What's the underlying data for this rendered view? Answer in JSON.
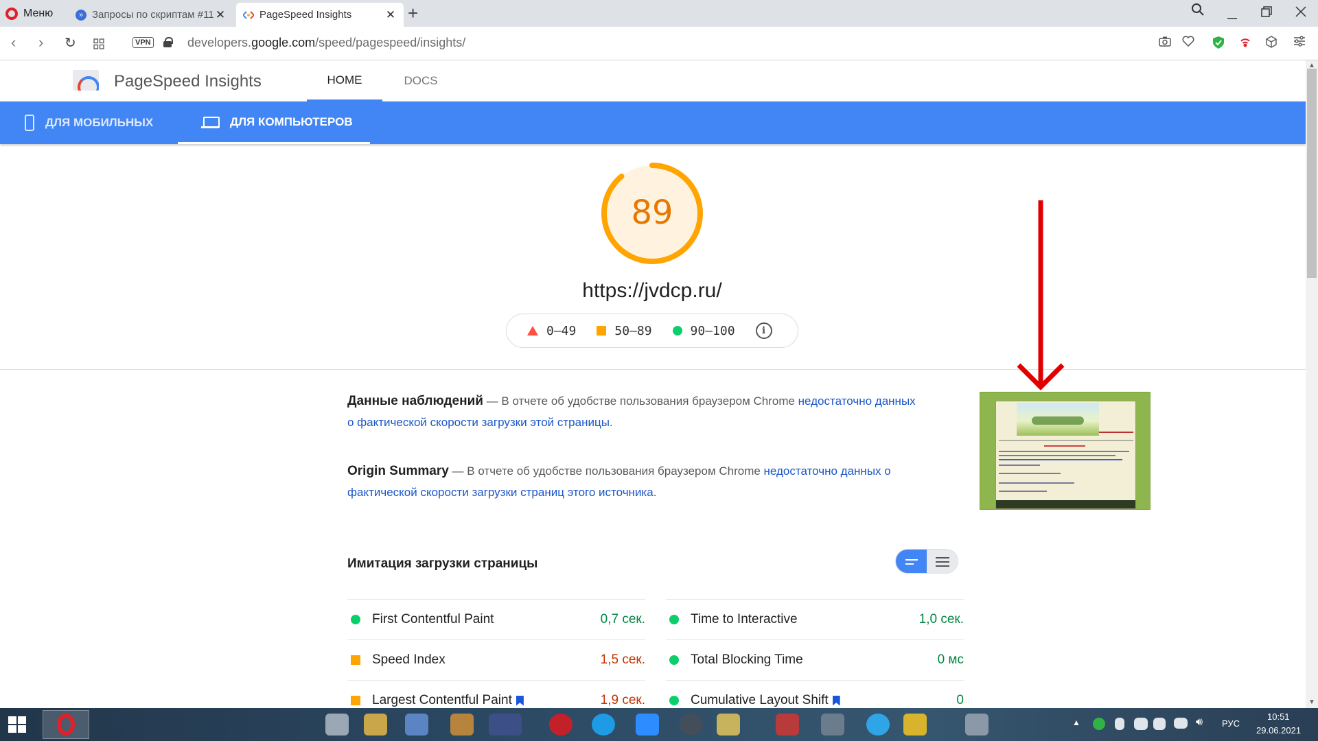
{
  "browser": {
    "menu_label": "Меню",
    "tabs": [
      {
        "label": "Запросы по скриптам #11",
        "active": false
      },
      {
        "label": "PageSpeed Insights",
        "active": true
      }
    ],
    "url_prefix": "developers.",
    "url_domain": "google.com",
    "url_path": "/speed/pagespeed/insights/",
    "vpn_label": "VPN"
  },
  "psi": {
    "title": "PageSpeed Insights",
    "nav": [
      {
        "label": "HOME",
        "active": true
      },
      {
        "label": "DOCS",
        "active": false
      }
    ],
    "device_tabs": [
      {
        "label": "ДЛЯ МОБИЛЬНЫХ",
        "active": false
      },
      {
        "label": "ДЛЯ КОМПЬЮТЕРОВ",
        "active": true
      }
    ],
    "score": "89",
    "score_value": 89,
    "score_color": "#ffa400",
    "tested_url": "https://jvdcp.ru/",
    "legend": [
      {
        "range": "0–49",
        "color": "#ff4e42"
      },
      {
        "range": "50–89",
        "color": "#ffa400"
      },
      {
        "range": "90–100",
        "color": "#0cce6b"
      }
    ],
    "field_data": {
      "title": "Данные наблюдений",
      "text": " — В отчете об удобстве пользования браузером Chrome ",
      "link": "недостаточно данных о фактической скорости загрузки этой страницы",
      "suffix": "."
    },
    "origin_summary": {
      "title": "Origin Summary",
      "text": " — В отчете об удобстве пользования браузером Chrome ",
      "link": "недостаточно данных о фактической скорости загрузки страниц этого источника",
      "suffix": "."
    },
    "lab_title": "Имитация загрузки страницы",
    "metrics_left": [
      {
        "name": "First Contentful Paint",
        "value": "0,7 сек.",
        "status": "pass"
      },
      {
        "name": "Speed Index",
        "value": "1,5 сек.",
        "status": "average"
      },
      {
        "name": "Largest Contentful Paint",
        "value": "1,9 сек.",
        "status": "average"
      }
    ],
    "metrics_right": [
      {
        "name": "Time to Interactive",
        "value": "1,0 сек.",
        "status": "pass"
      },
      {
        "name": "Total Blocking Time",
        "value": "0 мс",
        "status": "pass"
      },
      {
        "name": "Cumulative Layout Shift",
        "value": "0",
        "status": "pass"
      }
    ]
  },
  "taskbar": {
    "language": "РУС",
    "time": "10:51",
    "date": "29.06.2021"
  },
  "colors": {
    "accent": "#4285f4",
    "pass": "#0cce6b",
    "average": "#ffa400",
    "fail": "#ff4e42",
    "link": "#1a56c8",
    "annotation_arrow": "#e00000"
  }
}
